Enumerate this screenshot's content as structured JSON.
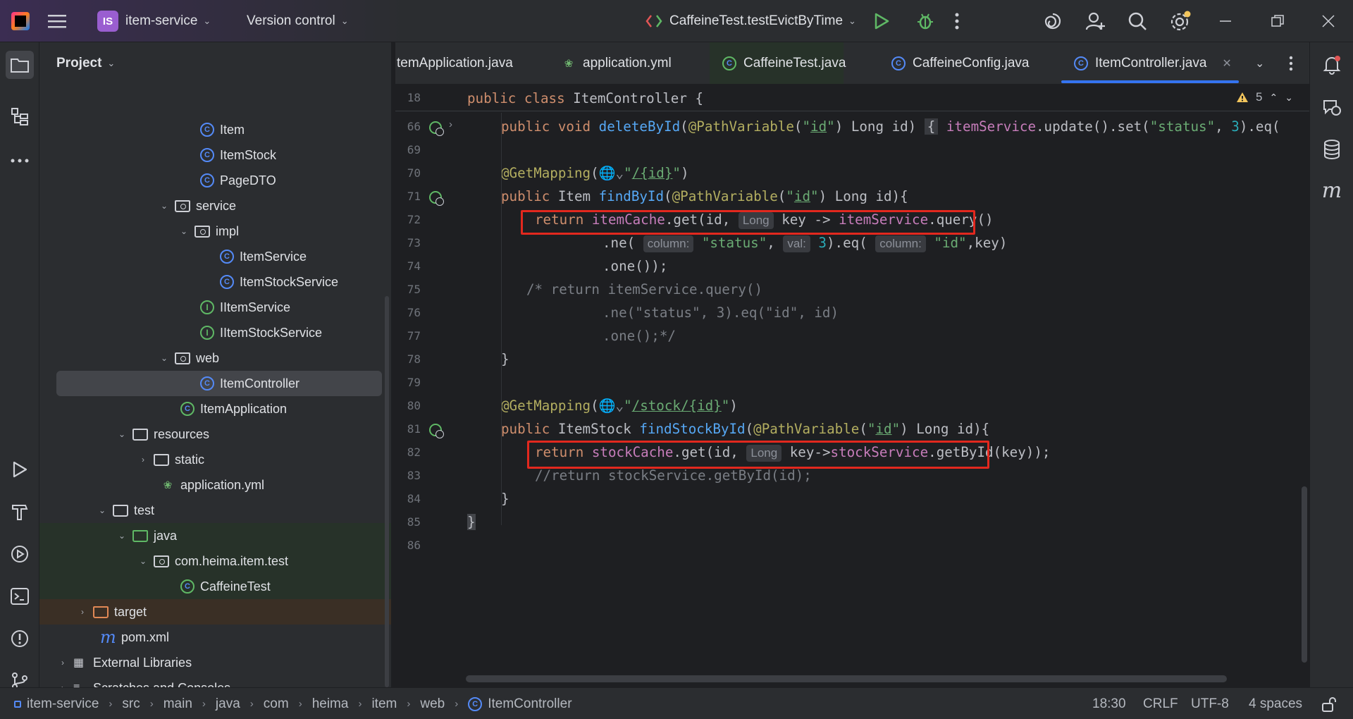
{
  "titlebar": {
    "project_badge": "IS",
    "project_name": "item-service",
    "vcs_label": "Version control",
    "run_config": "CaffeineTest.testEvictByTime"
  },
  "project_panel": {
    "title": "Project",
    "tree": [
      {
        "label": "Item",
        "icon": "class-icon"
      },
      {
        "label": "ItemStock",
        "icon": "class-icon"
      },
      {
        "label": "PageDTO",
        "icon": "class-icon"
      },
      {
        "label": "service",
        "icon": "package-icon"
      },
      {
        "label": "impl",
        "icon": "package-icon"
      },
      {
        "label": "ItemService",
        "icon": "class-icon"
      },
      {
        "label": "ItemStockService",
        "icon": "class-icon"
      },
      {
        "label": "IItemService",
        "icon": "interface-icon"
      },
      {
        "label": "IItemStockService",
        "icon": "interface-icon"
      },
      {
        "label": "web",
        "icon": "package-icon"
      },
      {
        "label": "ItemController",
        "icon": "class-icon"
      },
      {
        "label": "ItemApplication",
        "icon": "spring-class-icon"
      },
      {
        "label": "resources",
        "icon": "resources-folder-icon"
      },
      {
        "label": "static",
        "icon": "folder-icon"
      },
      {
        "label": "application.yml",
        "icon": "yaml-icon"
      },
      {
        "label": "test",
        "icon": "folder-icon"
      },
      {
        "label": "java",
        "icon": "test-folder-icon"
      },
      {
        "label": "com.heima.item.test",
        "icon": "package-icon"
      },
      {
        "label": "CaffeineTest",
        "icon": "test-class-icon"
      },
      {
        "label": "target",
        "icon": "excluded-folder-icon"
      },
      {
        "label": "pom.xml",
        "icon": "maven-icon"
      },
      {
        "label": "External Libraries",
        "icon": "library-icon"
      },
      {
        "label": "Scratches and Consoles",
        "icon": "scratches-icon"
      }
    ]
  },
  "tabs": [
    {
      "label": "temApplication.java"
    },
    {
      "label": "application.yml"
    },
    {
      "label": "CaffeineTest.java"
    },
    {
      "label": "CaffeineConfig.java"
    },
    {
      "label": "ItemController.java"
    }
  ],
  "editor": {
    "warning_count": "5",
    "sticky_line_number": "18",
    "sticky_line": "public class ItemController {",
    "line_numbers": [
      "66",
      "69",
      "70",
      "71",
      "72",
      "73",
      "74",
      "75",
      "76",
      "77",
      "78",
      "79",
      "80",
      "81",
      "82",
      "83",
      "84",
      "85",
      "86"
    ],
    "hints": {
      "long": "Long",
      "column": "column:",
      "val": "val:"
    }
  },
  "statusbar": {
    "breadcrumbs": [
      "item-service",
      "src",
      "main",
      "java",
      "com",
      "heima",
      "item",
      "web",
      "ItemController"
    ],
    "position": "18:30",
    "line_separator": "CRLF",
    "encoding": "UTF-8",
    "indent": "4 spaces"
  },
  "colors": {
    "accent": "#3574f0",
    "highlight_box": "#e2281e"
  }
}
